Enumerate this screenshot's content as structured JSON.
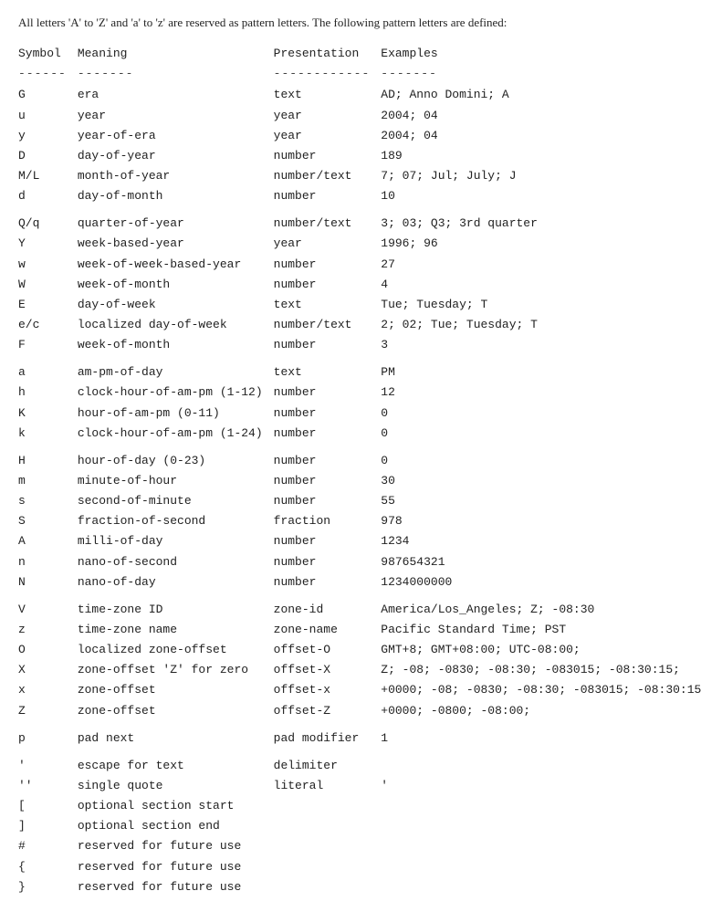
{
  "intro": "All letters 'A' to 'Z' and 'a' to 'z' are reserved as pattern letters. The following pattern letters are defined:",
  "headers": {
    "symbol": "Symbol",
    "meaning": "Meaning",
    "presentation": "Presentation",
    "examples": "Examples"
  },
  "dividers": {
    "symbol": "------",
    "meaning": "-------",
    "presentation": "------------",
    "examples": "-------"
  },
  "rows": [
    {
      "symbol": "G",
      "meaning": "era",
      "presentation": "text",
      "examples": "AD; Anno Domini; A",
      "spacer_after": false
    },
    {
      "symbol": "u",
      "meaning": "year",
      "presentation": "year",
      "examples": "2004; 04",
      "spacer_after": false
    },
    {
      "symbol": "y",
      "meaning": "year-of-era",
      "presentation": "year",
      "examples": "2004; 04",
      "spacer_after": false
    },
    {
      "symbol": "D",
      "meaning": "day-of-year",
      "presentation": "number",
      "examples": "189",
      "spacer_after": false
    },
    {
      "symbol": "M/L",
      "meaning": "month-of-year",
      "presentation": "number/text",
      "examples": "7; 07; Jul; July; J",
      "spacer_after": false
    },
    {
      "symbol": "d",
      "meaning": "day-of-month",
      "presentation": "number",
      "examples": "10",
      "spacer_after": true
    },
    {
      "symbol": "Q/q",
      "meaning": "quarter-of-year",
      "presentation": "number/text",
      "examples": "3; 03; Q3; 3rd quarter",
      "spacer_after": false
    },
    {
      "symbol": "Y",
      "meaning": "week-based-year",
      "presentation": "year",
      "examples": "1996; 96",
      "spacer_after": false
    },
    {
      "symbol": "w",
      "meaning": "week-of-week-based-year",
      "presentation": "number",
      "examples": "27",
      "spacer_after": false
    },
    {
      "symbol": "W",
      "meaning": "week-of-month",
      "presentation": "number",
      "examples": "4",
      "spacer_after": false
    },
    {
      "symbol": "E",
      "meaning": "day-of-week",
      "presentation": "text",
      "examples": "Tue; Tuesday; T",
      "spacer_after": false
    },
    {
      "symbol": "e/c",
      "meaning": "localized day-of-week",
      "presentation": "number/text",
      "examples": "2; 02; Tue; Tuesday; T",
      "spacer_after": false
    },
    {
      "symbol": "F",
      "meaning": "week-of-month",
      "presentation": "number",
      "examples": "3",
      "spacer_after": true
    },
    {
      "symbol": "a",
      "meaning": "am-pm-of-day",
      "presentation": "text",
      "examples": "PM",
      "spacer_after": false
    },
    {
      "symbol": "h",
      "meaning": "clock-hour-of-am-pm (1-12)",
      "presentation": "number",
      "examples": "12",
      "spacer_after": false
    },
    {
      "symbol": "K",
      "meaning": "hour-of-am-pm (0-11)",
      "presentation": "number",
      "examples": "0",
      "spacer_after": false
    },
    {
      "symbol": "k",
      "meaning": "clock-hour-of-am-pm (1-24)",
      "presentation": "number",
      "examples": "0",
      "spacer_after": true
    },
    {
      "symbol": "H",
      "meaning": "hour-of-day (0-23)",
      "presentation": "number",
      "examples": "0",
      "spacer_after": false
    },
    {
      "symbol": "m",
      "meaning": "minute-of-hour",
      "presentation": "number",
      "examples": "30",
      "spacer_after": false
    },
    {
      "symbol": "s",
      "meaning": "second-of-minute",
      "presentation": "number",
      "examples": "55",
      "spacer_after": false
    },
    {
      "symbol": "S",
      "meaning": "fraction-of-second",
      "presentation": "fraction",
      "examples": "978",
      "spacer_after": false
    },
    {
      "symbol": "A",
      "meaning": "milli-of-day",
      "presentation": "number",
      "examples": "1234",
      "spacer_after": false
    },
    {
      "symbol": "n",
      "meaning": "nano-of-second",
      "presentation": "number",
      "examples": "987654321",
      "spacer_after": false
    },
    {
      "symbol": "N",
      "meaning": "nano-of-day",
      "presentation": "number",
      "examples": "1234000000",
      "spacer_after": true
    },
    {
      "symbol": "V",
      "meaning": "time-zone ID",
      "presentation": "zone-id",
      "examples": "America/Los_Angeles; Z; -08:30",
      "spacer_after": false
    },
    {
      "symbol": "z",
      "meaning": "time-zone name",
      "presentation": "zone-name",
      "examples": "Pacific Standard Time; PST",
      "spacer_after": false
    },
    {
      "symbol": "O",
      "meaning": "localized zone-offset",
      "presentation": "offset-O",
      "examples": "GMT+8; GMT+08:00; UTC-08:00;",
      "spacer_after": false
    },
    {
      "symbol": "X",
      "meaning": "zone-offset 'Z' for zero",
      "presentation": "offset-X",
      "examples": "Z; -08; -0830; -08:30; -083015; -08:30:15;",
      "spacer_after": false
    },
    {
      "symbol": "x",
      "meaning": "zone-offset",
      "presentation": "offset-x",
      "examples": "+0000; -08; -0830; -08:30; -083015; -08:30:15;",
      "spacer_after": false
    },
    {
      "symbol": "Z",
      "meaning": "zone-offset",
      "presentation": "offset-Z",
      "examples": "+0000; -0800; -08:00;",
      "spacer_after": true
    },
    {
      "symbol": "p",
      "meaning": "pad next",
      "presentation": "pad modifier",
      "examples": "1",
      "spacer_after": true
    },
    {
      "symbol": "'",
      "meaning": "escape for text",
      "presentation": "delimiter",
      "examples": "",
      "spacer_after": false
    },
    {
      "symbol": "''",
      "meaning": "single quote",
      "presentation": "literal",
      "examples": "'",
      "spacer_after": false
    },
    {
      "symbol": "[",
      "meaning": "optional section start",
      "presentation": "",
      "examples": "",
      "spacer_after": false
    },
    {
      "symbol": "]",
      "meaning": "optional section end",
      "presentation": "",
      "examples": "",
      "spacer_after": false
    },
    {
      "symbol": "#",
      "meaning": "reserved for future use",
      "presentation": "",
      "examples": "",
      "spacer_after": false
    },
    {
      "symbol": "{",
      "meaning": "reserved for future use",
      "presentation": "",
      "examples": "",
      "spacer_after": false
    },
    {
      "symbol": "}",
      "meaning": "reserved for future use",
      "presentation": "",
      "examples": "",
      "spacer_after": false
    }
  ]
}
